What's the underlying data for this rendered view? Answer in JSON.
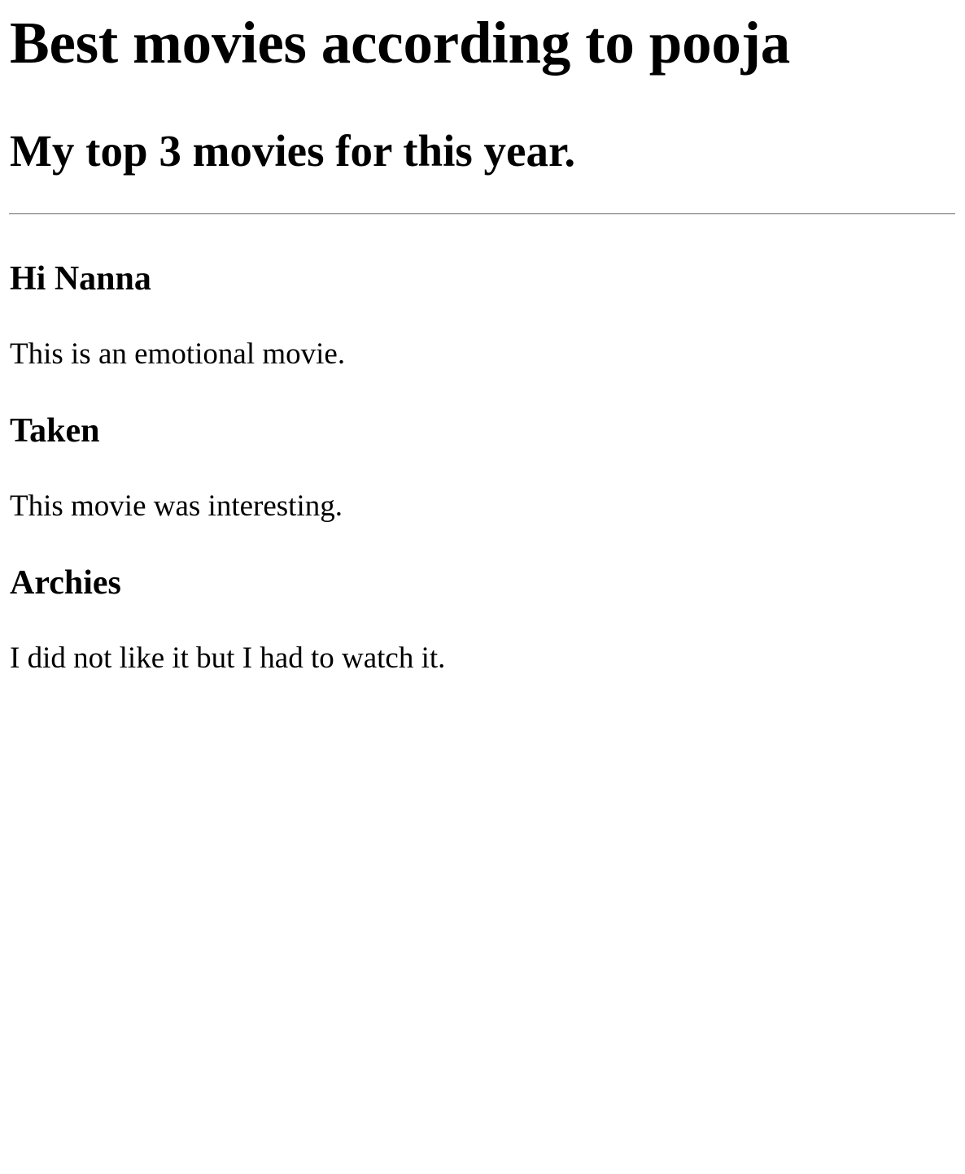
{
  "page": {
    "title": "Best movies according to pooja",
    "subtitle": "My top 3 movies for this year."
  },
  "movies": [
    {
      "title": "Hi Nanna",
      "description": "This is an emotional movie."
    },
    {
      "title": "Taken",
      "description": "This movie was interesting."
    },
    {
      "title": "Archies",
      "description": "I did not like it but I had to watch it."
    }
  ]
}
